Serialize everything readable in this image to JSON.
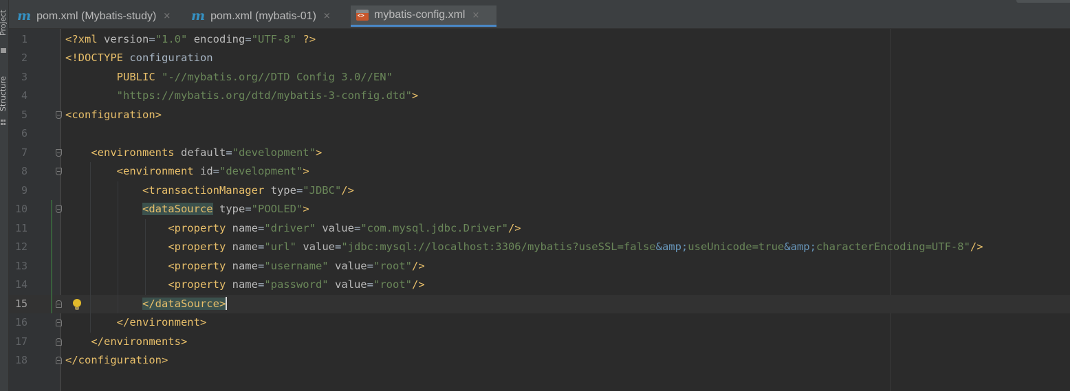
{
  "tool_strip": {
    "project_label": "Project",
    "structure_label": "Structure"
  },
  "tabs": [
    {
      "label": "pom.xml (Mybatis-study)",
      "icon": "maven-icon",
      "close": "×",
      "active": false
    },
    {
      "label": "pom.xml (mybatis-01)",
      "icon": "maven-icon",
      "close": "×",
      "active": false
    },
    {
      "label": "mybatis-config.xml",
      "icon": "xml-file-icon",
      "close": "×",
      "active": true
    }
  ],
  "icon_glyphs": {
    "maven": "m"
  },
  "editor": {
    "current_line": 15,
    "lines": [
      {
        "n": "1",
        "tokens": [
          [
            "pi",
            "<?xml "
          ],
          [
            "attr",
            "version"
          ],
          [
            "plain",
            "="
          ],
          [
            "val",
            "\"1.0\""
          ],
          [
            "plain",
            " "
          ],
          [
            "attr",
            "encoding"
          ],
          [
            "plain",
            "="
          ],
          [
            "val",
            "\"UTF-8\""
          ],
          [
            "plain",
            " "
          ],
          [
            "pi",
            "?>"
          ]
        ]
      },
      {
        "n": "2",
        "tokens": [
          [
            "tag",
            "<!DOCTYPE "
          ],
          [
            "plain",
            "configuration"
          ]
        ]
      },
      {
        "n": "3",
        "tokens": [
          [
            "plain",
            "        "
          ],
          [
            "tag",
            "PUBLIC "
          ],
          [
            "val",
            "\"-//mybatis.org//DTD Config 3.0//EN\""
          ]
        ]
      },
      {
        "n": "4",
        "tokens": [
          [
            "plain",
            "        "
          ],
          [
            "val",
            "\"https://mybatis.org/dtd/mybatis-3-config.dtd\""
          ],
          [
            "tag",
            ">"
          ]
        ]
      },
      {
        "n": "5",
        "tokens": [
          [
            "tag",
            "<configuration>"
          ]
        ]
      },
      {
        "n": "6",
        "tokens": []
      },
      {
        "n": "7",
        "tokens": [
          [
            "plain",
            "    "
          ],
          [
            "tag",
            "<environments "
          ],
          [
            "attr",
            "default"
          ],
          [
            "plain",
            "="
          ],
          [
            "val",
            "\"development\""
          ],
          [
            "tag",
            ">"
          ]
        ]
      },
      {
        "n": "8",
        "tokens": [
          [
            "plain",
            "        "
          ],
          [
            "tag",
            "<environment "
          ],
          [
            "attr",
            "id"
          ],
          [
            "plain",
            "="
          ],
          [
            "val",
            "\"development\""
          ],
          [
            "tag",
            ">"
          ]
        ]
      },
      {
        "n": "9",
        "tokens": [
          [
            "plain",
            "            "
          ],
          [
            "tag",
            "<transactionManager "
          ],
          [
            "attr",
            "type"
          ],
          [
            "plain",
            "="
          ],
          [
            "val",
            "\"JDBC\""
          ],
          [
            "tag",
            "/>"
          ]
        ]
      },
      {
        "n": "10",
        "tokens": [
          [
            "plain",
            "            "
          ],
          [
            "taghl",
            "<dataSource"
          ],
          [
            "plain",
            " "
          ],
          [
            "attr",
            "type"
          ],
          [
            "plain",
            "="
          ],
          [
            "val",
            "\"POOLED\""
          ],
          [
            "tag",
            ">"
          ]
        ]
      },
      {
        "n": "11",
        "tokens": [
          [
            "plain",
            "                "
          ],
          [
            "tag",
            "<property "
          ],
          [
            "attr",
            "name"
          ],
          [
            "plain",
            "="
          ],
          [
            "val",
            "\"driver\""
          ],
          [
            "plain",
            " "
          ],
          [
            "attr",
            "value"
          ],
          [
            "plain",
            "="
          ],
          [
            "val",
            "\"com.mysql.jdbc.Driver\""
          ],
          [
            "tag",
            "/>"
          ]
        ]
      },
      {
        "n": "12",
        "tokens": [
          [
            "plain",
            "                "
          ],
          [
            "tag",
            "<property "
          ],
          [
            "attr",
            "name"
          ],
          [
            "plain",
            "="
          ],
          [
            "val",
            "\"url\""
          ],
          [
            "plain",
            " "
          ],
          [
            "attr",
            "value"
          ],
          [
            "plain",
            "="
          ],
          [
            "val",
            "\"jdbc:mysql://localhost:3306/mybatis?useSSL=false"
          ],
          [
            "ent",
            "&amp;"
          ],
          [
            "val",
            "useUnicode=true"
          ],
          [
            "ent",
            "&amp;"
          ],
          [
            "val",
            "characterEncoding=UTF-8\""
          ],
          [
            "tag",
            "/>"
          ]
        ]
      },
      {
        "n": "13",
        "tokens": [
          [
            "plain",
            "                "
          ],
          [
            "tag",
            "<property "
          ],
          [
            "attr",
            "name"
          ],
          [
            "plain",
            "="
          ],
          [
            "val",
            "\"username\""
          ],
          [
            "plain",
            " "
          ],
          [
            "attr",
            "value"
          ],
          [
            "plain",
            "="
          ],
          [
            "val",
            "\"root\""
          ],
          [
            "tag",
            "/>"
          ]
        ]
      },
      {
        "n": "14",
        "tokens": [
          [
            "plain",
            "                "
          ],
          [
            "tag",
            "<property "
          ],
          [
            "attr",
            "name"
          ],
          [
            "plain",
            "="
          ],
          [
            "val",
            "\"password\""
          ],
          [
            "plain",
            " "
          ],
          [
            "attr",
            "value"
          ],
          [
            "plain",
            "="
          ],
          [
            "val",
            "\"root\""
          ],
          [
            "tag",
            "/>"
          ]
        ]
      },
      {
        "n": "15",
        "tokens": [
          [
            "plain",
            "            "
          ],
          [
            "taghl",
            "</dataSource>"
          ]
        ]
      },
      {
        "n": "16",
        "tokens": [
          [
            "plain",
            "        "
          ],
          [
            "tag",
            "</environment>"
          ]
        ]
      },
      {
        "n": "17",
        "tokens": [
          [
            "plain",
            "    "
          ],
          [
            "tag",
            "</environments>"
          ]
        ]
      },
      {
        "n": "18",
        "tokens": [
          [
            "tag",
            "</configuration>"
          ]
        ]
      }
    ]
  }
}
